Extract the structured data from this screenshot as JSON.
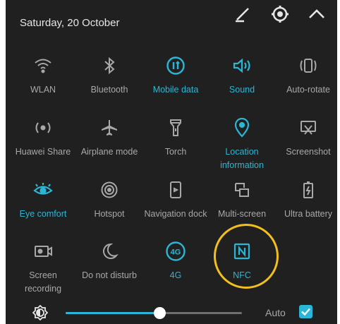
{
  "header": {
    "date": "Saturday, 20 October"
  },
  "tiles": [
    {
      "label": "WLAN",
      "icon": "wifi-icon",
      "active": false
    },
    {
      "label": "Bluetooth",
      "icon": "bluetooth-icon",
      "active": false
    },
    {
      "label": "Mobile data",
      "icon": "mobile-data-icon",
      "active": true
    },
    {
      "label": "Sound",
      "icon": "sound-icon",
      "active": true
    },
    {
      "label": "Auto-rotate",
      "icon": "auto-rotate-icon",
      "active": false
    },
    {
      "label": "Huawei Share",
      "icon": "huawei-share-icon",
      "active": false
    },
    {
      "label": "Airplane mode",
      "icon": "airplane-icon",
      "active": false
    },
    {
      "label": "Torch",
      "icon": "torch-icon",
      "active": false
    },
    {
      "label": "Location information",
      "icon": "location-icon",
      "active": true
    },
    {
      "label": "Screenshot",
      "icon": "screenshot-icon",
      "active": false
    },
    {
      "label": "Eye comfort",
      "icon": "eye-icon",
      "active": true
    },
    {
      "label": "Hotspot",
      "icon": "hotspot-icon",
      "active": false
    },
    {
      "label": "Navigation dock",
      "icon": "navigation-dock-icon",
      "active": false
    },
    {
      "label": "Multi-screen",
      "icon": "multi-screen-icon",
      "active": false
    },
    {
      "label": "Ultra battery",
      "icon": "ultra-battery-icon",
      "active": false
    },
    {
      "label": "Screen recording",
      "icon": "screen-recording-icon",
      "active": false
    },
    {
      "label": "Do not disturb",
      "icon": "moon-icon",
      "active": false
    },
    {
      "label": "4G",
      "icon": "4g-icon",
      "active": true
    },
    {
      "label": "NFC",
      "icon": "nfc-icon",
      "active": true
    }
  ],
  "brightness": {
    "level": 0.53,
    "auto_label": "Auto",
    "auto_checked": true
  },
  "colors": {
    "accent": "#2bb6d6",
    "background": "#202020",
    "inactive": "#a8a8a8",
    "highlight_ring": "#f2bf1d"
  }
}
